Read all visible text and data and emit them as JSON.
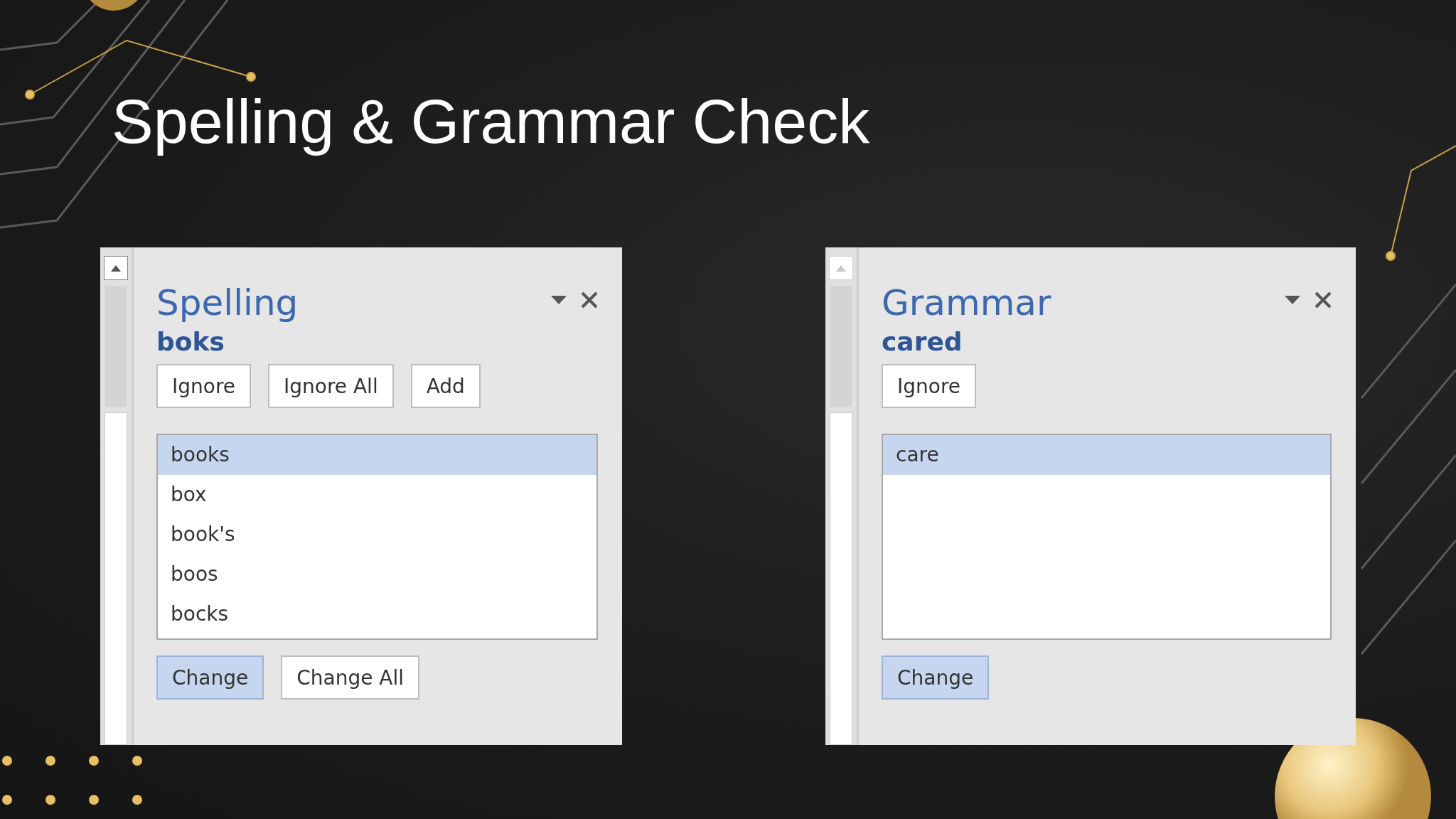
{
  "title": "Spelling & Grammar Check",
  "panes": [
    {
      "heading": "Spelling",
      "word": "boks",
      "scroll_disabled": false,
      "actions": [
        "Ignore",
        "Ignore All",
        "Add"
      ],
      "suggestions": [
        {
          "text": "books",
          "selected": true
        },
        {
          "text": "box",
          "selected": false
        },
        {
          "text": "book's",
          "selected": false
        },
        {
          "text": "boos",
          "selected": false
        },
        {
          "text": "bocks",
          "selected": false
        }
      ],
      "change_buttons": [
        {
          "label": "Change",
          "default": true
        },
        {
          "label": "Change All",
          "default": false
        }
      ]
    },
    {
      "heading": "Grammar",
      "word": "cared",
      "scroll_disabled": true,
      "actions": [
        "Ignore"
      ],
      "suggestions": [
        {
          "text": "care",
          "selected": true
        }
      ],
      "change_buttons": [
        {
          "label": "Change",
          "default": true
        }
      ]
    }
  ]
}
